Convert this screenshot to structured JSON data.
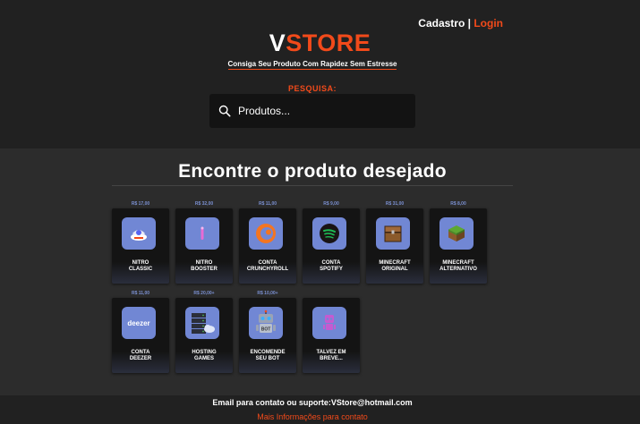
{
  "header": {
    "register_label": "Cadastro",
    "separator": "|",
    "login_label": "Login",
    "logo_v": "V",
    "logo_rest": "STORE",
    "tagline": "Consiga Seu Produto Com Rapidez Sem Estresse",
    "search_label": "PESQUISA:",
    "search_placeholder": "Produtos..."
  },
  "main": {
    "title": "Encontre o produto desejado"
  },
  "products": [
    {
      "price": "R$ 17,00",
      "name_line1": "NITRO",
      "name_line2": "CLASSIC",
      "icon": "nitro-classic-icon"
    },
    {
      "price": "R$ 32,00",
      "name_line1": "NITRO",
      "name_line2": "BOOSTER",
      "icon": "nitro-booster-icon"
    },
    {
      "price": "R$ 11,00",
      "name_line1": "CONTA",
      "name_line2": "CRUNCHYROLL",
      "icon": "crunchyroll-icon"
    },
    {
      "price": "R$ 9,00",
      "name_line1": "CONTA",
      "name_line2": "SPOTIFY",
      "icon": "spotify-icon"
    },
    {
      "price": "R$ 31,00",
      "name_line1": "MINECRAFT",
      "name_line2": "ORIGINAL",
      "icon": "minecraft-chest-icon"
    },
    {
      "price": "R$ 8,00",
      "name_line1": "MINECRAFT",
      "name_line2": "ALTERNATIVO",
      "icon": "minecraft-grass-icon"
    },
    {
      "price": "R$ 11,00",
      "name_line1": "CONTA",
      "name_line2": "DEEZER",
      "icon": "deezer-icon"
    },
    {
      "price": "R$ 20,00+",
      "name_line1": "HOSTING",
      "name_line2": "GAMES",
      "icon": "server-icon"
    },
    {
      "price": "R$ 10,00+",
      "name_line1": "ENCOMENDE",
      "name_line2": "SEU BOT",
      "icon": "robot-icon"
    },
    {
      "price": "",
      "name_line1": "TALVEZ EM",
      "name_line2": "BREVE...",
      "icon": "coming-soon-icon"
    }
  ],
  "footer": {
    "email_text": "Email para contato ou suporte:VStore@hotmail.com",
    "more_info": "Mais Informações para contato"
  },
  "colors": {
    "accent": "#f24a1a",
    "card_icon_bg": "#7187d4",
    "price": "#7a8fd0"
  }
}
